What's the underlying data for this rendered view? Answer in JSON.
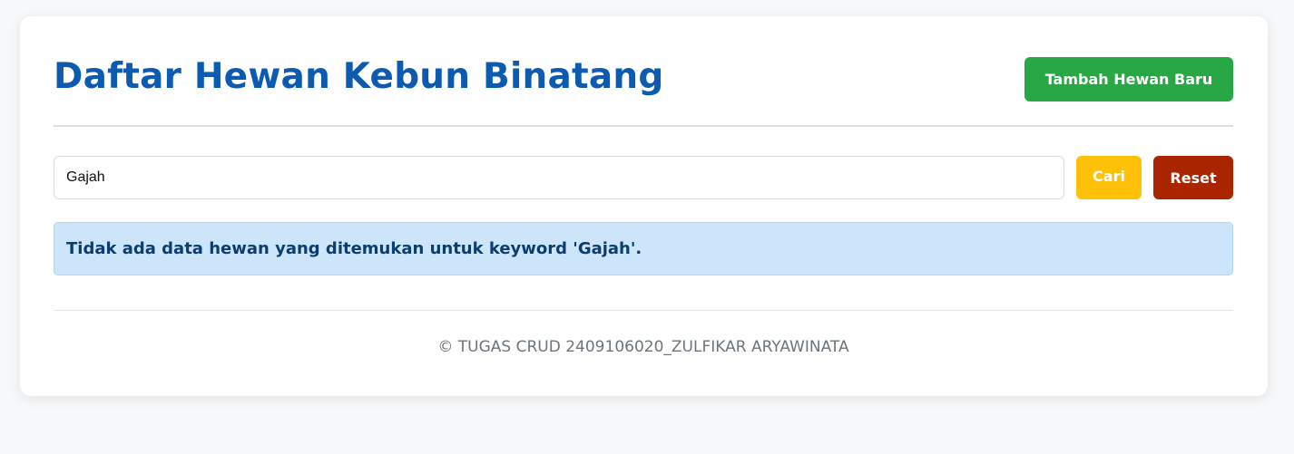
{
  "header": {
    "title": "Daftar Hewan Kebun Binatang",
    "add_button_label": "Tambah Hewan Baru"
  },
  "search": {
    "value": "Gajah",
    "search_button_label": "Cari",
    "reset_button_label": "Reset"
  },
  "alert": {
    "message": "Tidak ada data hewan yang ditemukan untuk keyword 'Gajah'."
  },
  "footer": {
    "text": "© TUGAS CRUD 2409106020_ZULFIKAR ARYAWINATA"
  },
  "colors": {
    "title": "#0d5bb0",
    "add_button": "#28a745",
    "search_button": "#ffc107",
    "reset_button": "#a92500",
    "alert_background": "#cce5fb",
    "alert_text": "#0b3d6f"
  }
}
